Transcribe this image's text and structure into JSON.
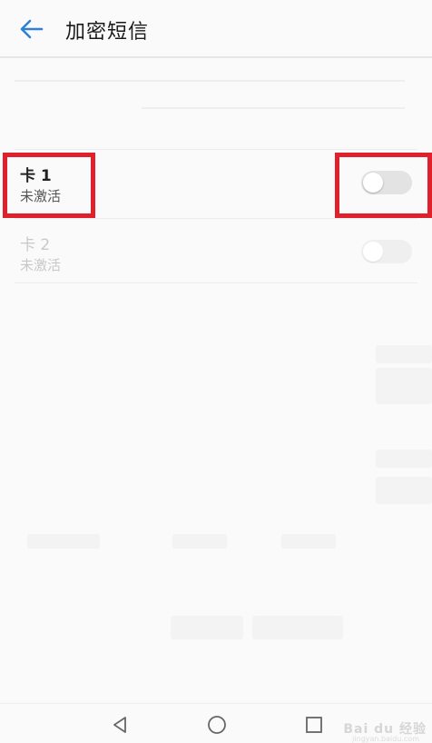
{
  "header": {
    "title": "加密短信",
    "back_icon": "arrow-left-icon",
    "accent_color": "#2f80d8"
  },
  "sim_rows": [
    {
      "title": "卡 1",
      "status": "未激活",
      "toggle_on": false,
      "highlighted": true
    },
    {
      "title": "卡 2",
      "status": "未激活",
      "toggle_on": false,
      "highlighted": false
    }
  ],
  "highlight_color": "#e0202a",
  "nav": {
    "back_icon": "triangle-back-icon",
    "home_icon": "circle-home-icon",
    "recents_icon": "square-recents-icon"
  },
  "watermark": {
    "text": "Bai du 经验",
    "sub": "jingyan.baidu.com"
  }
}
